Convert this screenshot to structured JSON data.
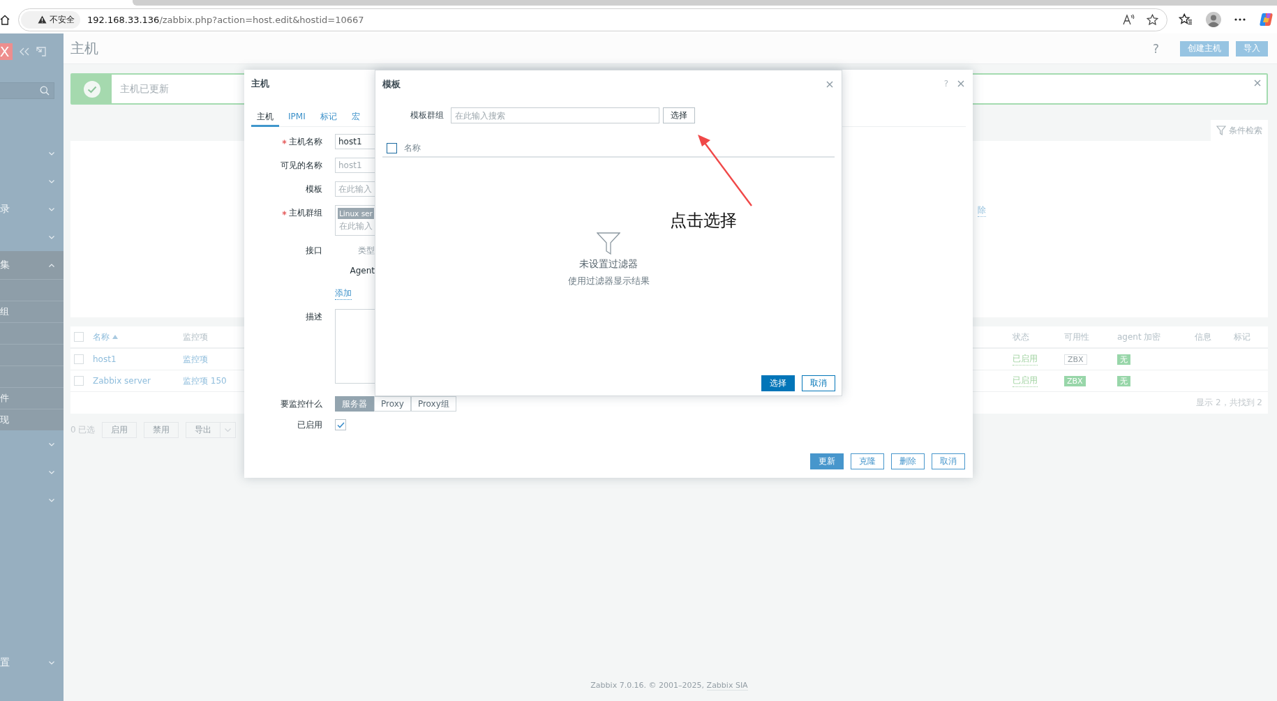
{
  "browser": {
    "security_label": "不安全",
    "url": "192.168.33.136/zabbix.php?action=host.edit&hostid=10667"
  },
  "sidebar": {
    "logo": "X",
    "sections": [
      {
        "kind": "group",
        "expanded": false
      },
      {
        "kind": "group",
        "expanded": false
      },
      {
        "kind": "group",
        "label": "录",
        "expanded": false
      },
      {
        "kind": "group",
        "expanded": false
      },
      {
        "kind": "group",
        "label": "集",
        "expanded": true,
        "children": [
          {
            "kind": "item"
          },
          {
            "kind": "item",
            "label": "组"
          },
          {
            "kind": "item"
          },
          {
            "kind": "item"
          },
          {
            "kind": "item"
          },
          {
            "kind": "item",
            "label": "件"
          },
          {
            "kind": "item",
            "label": "现"
          }
        ]
      },
      {
        "kind": "group",
        "expanded": false
      },
      {
        "kind": "group",
        "expanded": false
      },
      {
        "kind": "group",
        "expanded": false
      }
    ],
    "bottom": [
      {
        "kind": "group",
        "label": "置",
        "expanded": false
      }
    ]
  },
  "page": {
    "title": "主机",
    "help": "?",
    "buttons": [
      "创建主机",
      "导入"
    ]
  },
  "message": {
    "text": "主机已更新"
  },
  "filter": {
    "tab": "条件检索",
    "link": "除"
  },
  "hosts_table": {
    "header_checked": false,
    "columns": [
      {
        "label": "名称",
        "sorted": true
      },
      {
        "label": "监控项"
      },
      {
        "label": "状态"
      },
      {
        "label": "可用性"
      },
      {
        "label": "agent 加密"
      },
      {
        "label": "信息"
      },
      {
        "label": "标记"
      }
    ],
    "rows": [
      {
        "checked": false,
        "name": "host1",
        "items": "监控项",
        "status": "已启用",
        "availability": "ZBX",
        "available": false,
        "encryption": "无"
      },
      {
        "checked": false,
        "name": "Zabbix server",
        "items": "监控项 150",
        "status": "已启用",
        "availability": "ZBX",
        "available": true,
        "encryption": "无"
      }
    ],
    "summary": "显示 2，共找到 2"
  },
  "actions": {
    "selected": "0 已选",
    "buttons": [
      {
        "label": "启用",
        "disabled": true,
        "kind": "plain"
      },
      {
        "label": "禁用",
        "disabled": true,
        "kind": "plain"
      },
      {
        "label": "导出",
        "disabled": true,
        "kind": "split"
      }
    ]
  },
  "host_dialog": {
    "title": "主机",
    "help": "?",
    "tabs": [
      {
        "label": "主机",
        "selected": true
      },
      {
        "label": "IPMI",
        "selected": false
      },
      {
        "label": "标记",
        "selected": false
      },
      {
        "label": "宏",
        "selected": false
      }
    ],
    "fields": [
      {
        "kind": "text",
        "label": "主机名称",
        "required": true,
        "value": "host1"
      },
      {
        "kind": "text",
        "label": "可见的名称",
        "placeholder": "host1"
      },
      {
        "kind": "text",
        "label": "模板",
        "placeholder": "在此输入"
      },
      {
        "kind": "multiselect",
        "label": "主机群组",
        "required": true,
        "tag": "Linux ser",
        "placeholder": "在此输入"
      },
      {
        "kind": "interfaces",
        "label": "接口",
        "column": "类型",
        "type": "Agent",
        "link": "添加"
      },
      {
        "kind": "textarea",
        "label": "描述"
      },
      {
        "kind": "segmented",
        "label": "要监控什么",
        "options": [
          {
            "label": "服务器",
            "selected": true
          },
          {
            "label": "Proxy",
            "selected": false
          },
          {
            "label": "Proxy组",
            "selected": false
          }
        ]
      },
      {
        "kind": "checkbox",
        "label": "已启用",
        "checked": true
      }
    ],
    "buttons": [
      {
        "label": "更新",
        "primary": true
      },
      {
        "label": "克隆",
        "primary": false
      },
      {
        "label": "删除",
        "primary": false
      },
      {
        "label": "取消",
        "primary": false
      }
    ]
  },
  "template_dialog": {
    "title": "模板",
    "group_label": "模板群组",
    "group_placeholder": "在此输入搜索",
    "select_button": "选择",
    "column": "名称",
    "header_checked": false,
    "empty_title": "未设置过滤器",
    "empty_hint": "使用过滤器显示结果",
    "buttons": [
      {
        "label": "选择",
        "primary": true
      },
      {
        "label": "取消",
        "primary": false
      }
    ]
  },
  "annotation": {
    "text": "点击选择"
  },
  "footer": {
    "text": "Zabbix 7.0.16. © 2001–2025, ",
    "link": "Zabbix SIA"
  }
}
